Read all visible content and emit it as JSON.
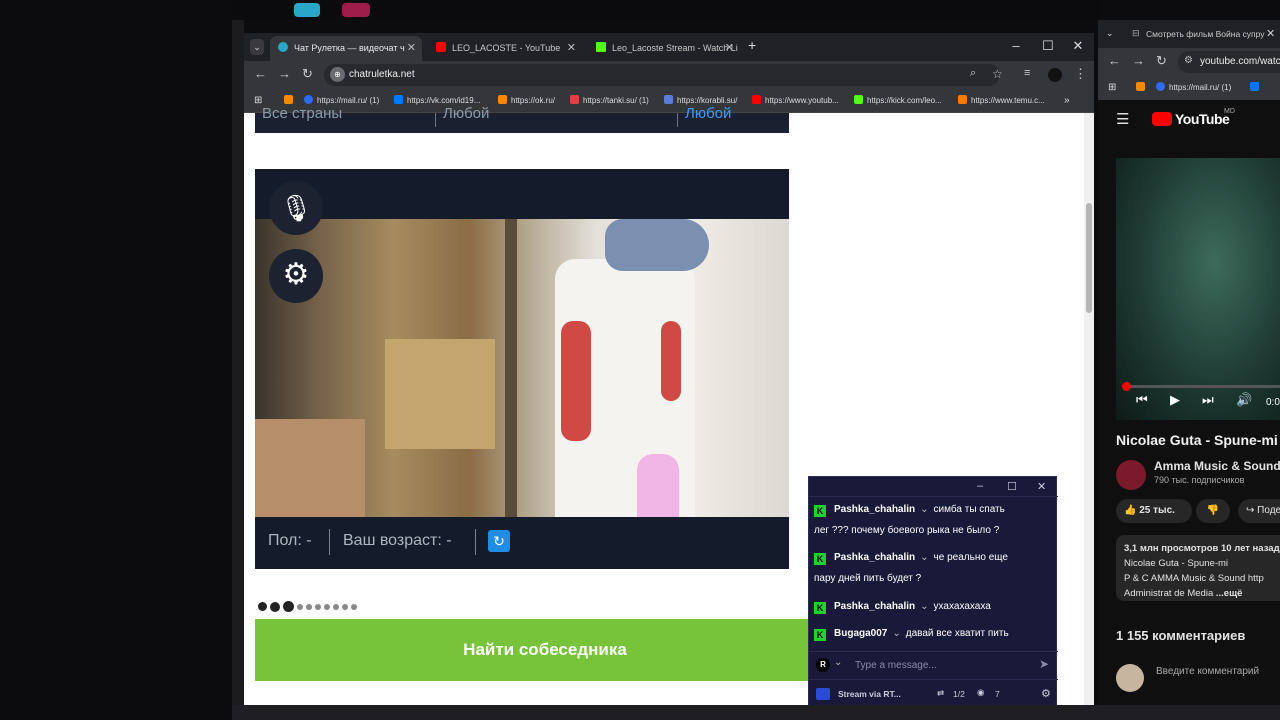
{
  "main_browser": {
    "tabs": [
      {
        "label": "Чат Рулетка — видеочат ч",
        "favicon_color": "#2aa7c6"
      },
      {
        "label": "LEO_LACOSTE - YouTube",
        "favicon_color": "#ff0000"
      },
      {
        "label": "Leo_Lacoste Stream - Watch Li",
        "favicon_color": "#53fc18"
      }
    ],
    "url": "chatruletka.net",
    "bookmarks": [
      {
        "label": "https://mail.ru/ (1)",
        "color": "#2b6cf5"
      },
      {
        "label": "https://vk.com/id19...",
        "color": "#0077ff"
      },
      {
        "label": "https://ok.ru/",
        "color": "#f28b00"
      },
      {
        "label": "https://tanki.su/ (1)",
        "color": "#e04040"
      },
      {
        "label": "https://korabli.su/",
        "color": "#5c7dd6"
      },
      {
        "label": "https://www.youtub...",
        "color": "#ff0000"
      },
      {
        "label": "https://kick.com/leo...",
        "color": "#53fc18"
      },
      {
        "label": "https://www.temu.c...",
        "color": "#f57c00"
      }
    ]
  },
  "page": {
    "filter": {
      "country": "Все страны",
      "gender": "Любой",
      "age": "Любой"
    },
    "gender_label": "Пол: -",
    "age_label": "Ваш возраст: -",
    "find_button": "Найти собеседника"
  },
  "chat": {
    "messages": [
      {
        "user": "Pashka_chahalin",
        "text": "симба ты спать",
        "cont": "лег ??? почему боевого рыка не было ?"
      },
      {
        "user": "Pashka_chahalin",
        "text": "че реально еще",
        "cont": "пару дней пить будет ?"
      },
      {
        "user": "Pashka_chahalin",
        "text": "ухахахахаха",
        "cont": ""
      },
      {
        "user": "Bugaga007",
        "text": "давай все хватит пить",
        "cont": ""
      }
    ],
    "input_placeholder": "Type a message...",
    "stream_label": "Stream via RT...",
    "page_counter": "1/2",
    "viewers": "7"
  },
  "youtube": {
    "tab_title": "Смотреть фильм Война супру",
    "url": "youtube.com/watc",
    "bm1": "https://mail.ru/ (1)",
    "logo": "YouTube",
    "logo_sup": "MD",
    "time": "0:0",
    "title": "Nicolae Guta - Spune-mi",
    "channel": "Amma Music & Sound",
    "subscribers": "790 тыс. подписчиков",
    "likes": "25 тыс.",
    "share": "Поде",
    "desc_line1": "3,1 млн просмотров  10 лет назад",
    "desc_line2": "Nicolae Guta - Spune-mi",
    "desc_line3": "P & C AMMA Music & Sound http",
    "desc_line4a": "Administrat de  Media",
    "desc_line4b": "...ещё",
    "comments_count": "1 155 комментариев",
    "comment_placeholder": "Введите комментарий"
  }
}
